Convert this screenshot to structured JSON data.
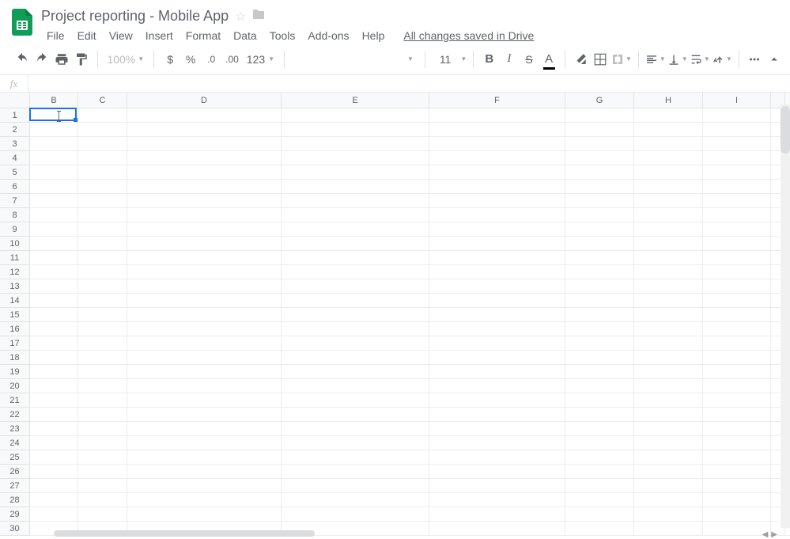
{
  "doc": {
    "title": "Project reporting - Mobile App"
  },
  "menu": {
    "file": "File",
    "edit": "Edit",
    "view": "View",
    "insert": "Insert",
    "format": "Format",
    "data": "Data",
    "tools": "Tools",
    "addons": "Add-ons",
    "help": "Help",
    "save_status": "All changes saved in Drive"
  },
  "toolbar": {
    "zoom": "100%",
    "currency": "$",
    "percent": "%",
    "dec_less": ".0",
    "dec_more": ".00",
    "num_format": "123",
    "font_size": "11"
  },
  "fx": {
    "label": "fx",
    "value": ""
  },
  "columns": [
    "B",
    "C",
    "D",
    "E",
    "F",
    "G",
    "H",
    "I",
    ""
  ],
  "rows": [
    "1",
    "2",
    "3",
    "4",
    "5",
    "6",
    "7",
    "8",
    "9",
    "10",
    "11",
    "12",
    "13",
    "14",
    "15",
    "16",
    "17",
    "18",
    "19",
    "20",
    "21",
    "22",
    "23",
    "24",
    "25",
    "26",
    "27",
    "28",
    "29",
    "30"
  ],
  "selection": {
    "cell": "B1"
  }
}
